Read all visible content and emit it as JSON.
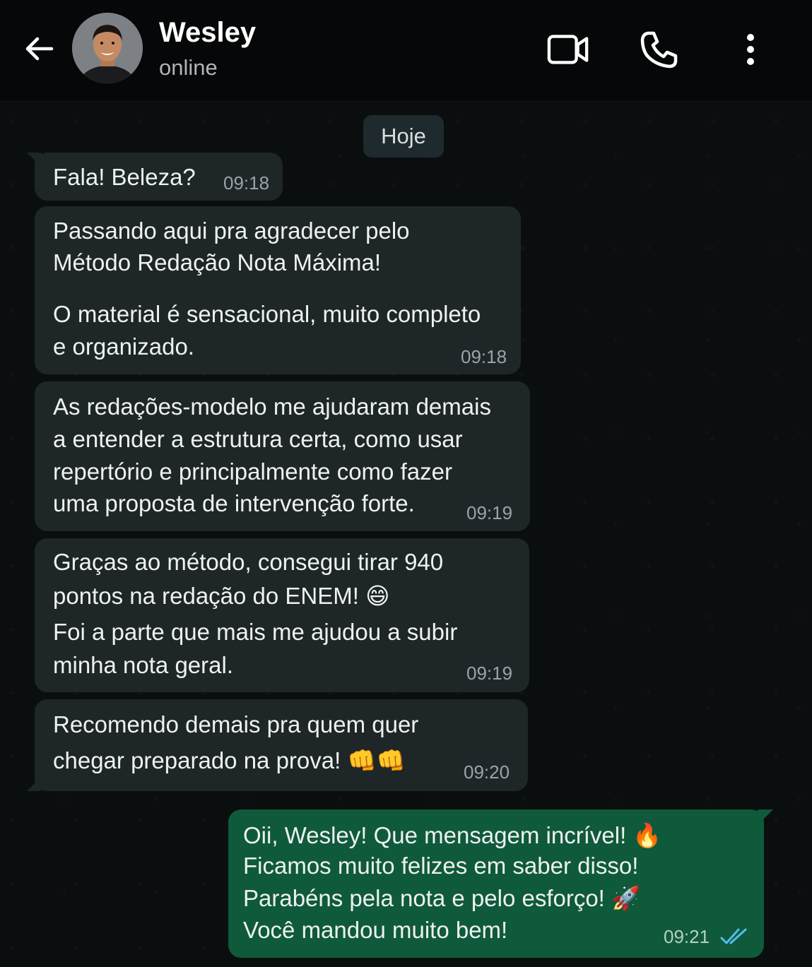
{
  "header": {
    "contact_name": "Wesley",
    "status": "online",
    "icons": [
      "back-arrow-icon",
      "video-call-icon",
      "phone-icon",
      "more-vert-icon"
    ]
  },
  "day_separator": "Hoje",
  "messages": [
    {
      "direction": "in",
      "lines": [
        "Fala! Beleza?"
      ],
      "time": "09:18"
    },
    {
      "direction": "in",
      "lines": [
        "Passando aqui pra agradecer pelo",
        "Método Redação Nota Máxima!",
        "",
        "O material é sensacional, muito completo",
        "e organizado."
      ],
      "time": "09:18"
    },
    {
      "direction": "in",
      "lines": [
        "As redações-modelo me ajudaram demais",
        "a entender a estrutura certa, como usar",
        "repertório e principalmente como fazer",
        "uma proposta de intervenção forte."
      ],
      "time": "09:19"
    },
    {
      "direction": "in",
      "lines": [
        "Graças ao método, consegui tirar 940",
        "pontos na redação do ENEM! 😄",
        "Foi a parte que mais me ajudou a subir",
        "minha nota geral."
      ],
      "time": "09:19"
    },
    {
      "direction": "in",
      "lines": [
        "Recomendo demais pra quem quer",
        "chegar preparado na prova! 👊👊"
      ],
      "time": "09:20"
    },
    {
      "direction": "out",
      "lines": [
        "Oii, Wesley! Que mensagem incrível! 🔥",
        "Ficamos muito felizes em saber disso!",
        "Parabéns pela nota e pelo esforço! 🚀",
        "Você mandou muito bem!"
      ],
      "time": "09:21",
      "read_receipt": "double-check-icon"
    }
  ],
  "colors": {
    "header_bg": "#050708",
    "chat_bg": "#0b0e0f",
    "incoming_bubble": "#1f2628",
    "outgoing_bubble": "#0f5a3a",
    "read_tick": "#53bdeb"
  }
}
